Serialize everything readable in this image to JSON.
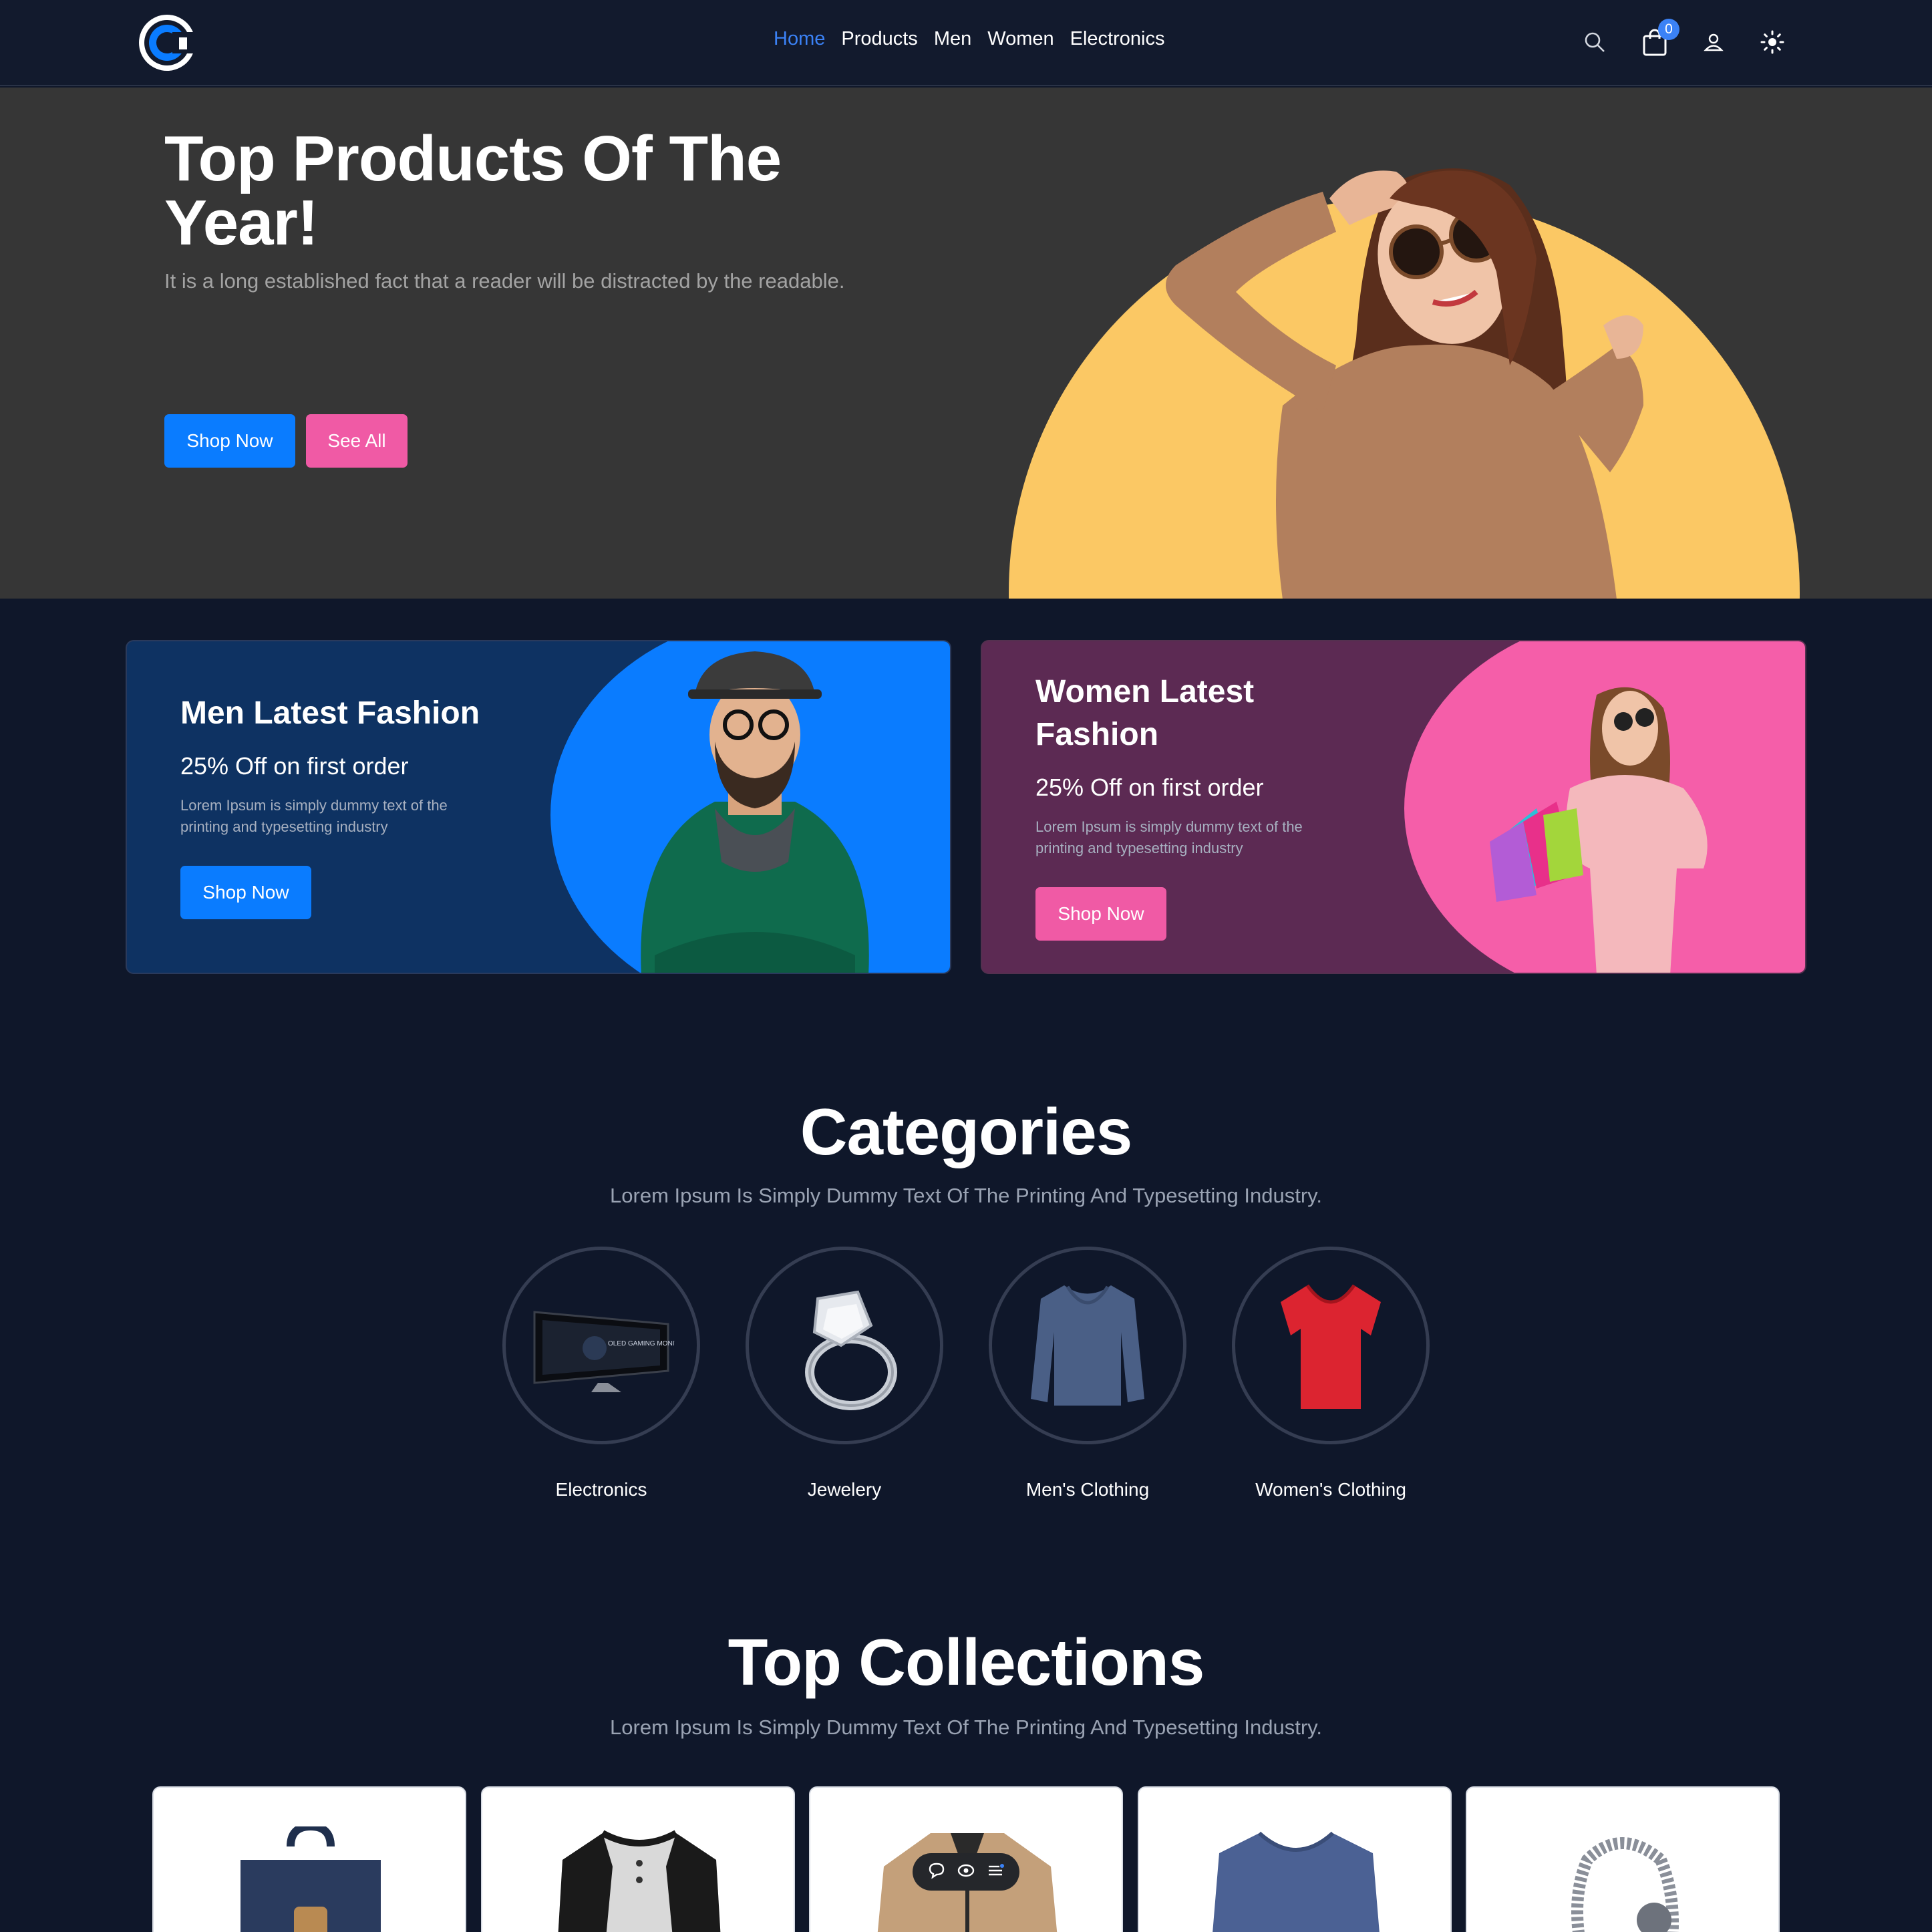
{
  "nav": {
    "links": [
      "Home",
      "Products",
      "Men",
      "Women",
      "Electronics"
    ],
    "active": "Home",
    "cart_count": "0"
  },
  "hero": {
    "title": "Top Products Of The Year!",
    "subtitle": "It is a long established fact that a reader will be distracted by the readable.",
    "shop_now": "Shop Now",
    "see_all": "See All"
  },
  "banners": {
    "men": {
      "title": "Men Latest Fashion",
      "offer": "25% Off on first order",
      "desc_line1": "Lorem Ipsum is simply dummy text of the",
      "desc_line2": "printing and typesetting industry",
      "button": "Shop Now"
    },
    "women": {
      "title_line1": "Women Latest",
      "title_line2": "Fashion",
      "offer": "25% Off on first order",
      "desc_line1": "Lorem Ipsum is simply dummy text of the",
      "desc_line2": "printing and typesetting industry",
      "button": "Shop Now"
    }
  },
  "categories": {
    "title": "Categories",
    "subtitle": "Lorem Ipsum Is Simply Dummy Text Of The Printing And Typesetting Industry.",
    "items": [
      {
        "label": "Electronics",
        "monitor_text": "OLED GAMING MONITOR"
      },
      {
        "label": "Jewelery"
      },
      {
        "label": "Men's Clothing"
      },
      {
        "label": "Women's Clothing"
      }
    ]
  },
  "collections": {
    "title": "Top Collections",
    "subtitle": "Lorem Ipsum Is Simply Dummy Text Of The Printing And Typesetting Industry."
  },
  "colors": {
    "bg": "#0f172a",
    "nav_bg": "#121a2d",
    "hero_bg": "#363636",
    "accent_blue": "#0a7cff",
    "accent_pink": "#f05aa5",
    "sun": "#fbc864"
  }
}
